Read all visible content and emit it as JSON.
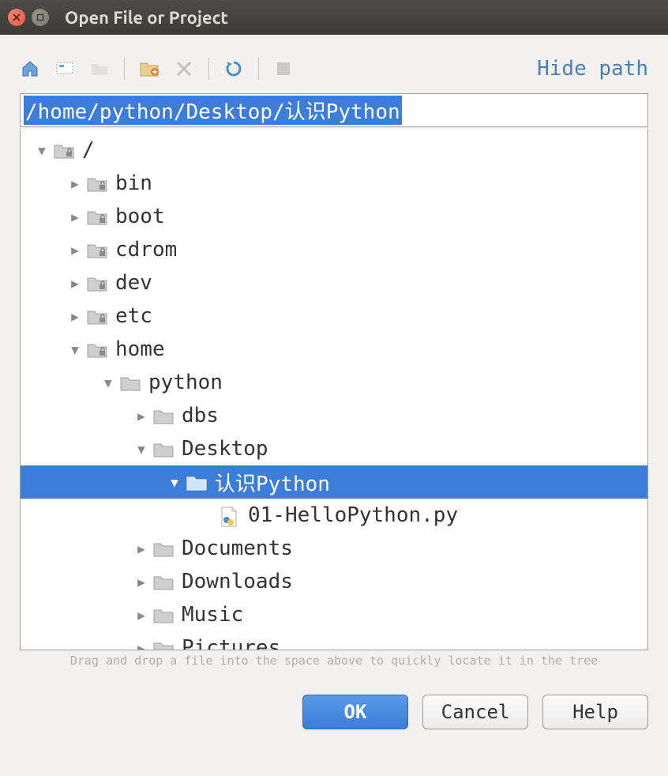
{
  "window": {
    "title": "Open File or Project"
  },
  "toolbar": {
    "hide_path": "Hide path"
  },
  "path_input": {
    "value": "/home/python/Desktop/认识Python"
  },
  "tree": {
    "items": [
      {
        "level": 0,
        "expanded": true,
        "kind": "folder-lock",
        "label": "/",
        "selected": false
      },
      {
        "level": 1,
        "expanded": false,
        "kind": "folder-lock",
        "label": "bin",
        "selected": false
      },
      {
        "level": 1,
        "expanded": false,
        "kind": "folder-lock",
        "label": "boot",
        "selected": false
      },
      {
        "level": 1,
        "expanded": false,
        "kind": "folder-lock",
        "label": "cdrom",
        "selected": false
      },
      {
        "level": 1,
        "expanded": false,
        "kind": "folder-lock",
        "label": "dev",
        "selected": false
      },
      {
        "level": 1,
        "expanded": false,
        "kind": "folder-lock",
        "label": "etc",
        "selected": false
      },
      {
        "level": 1,
        "expanded": true,
        "kind": "folder-lock",
        "label": "home",
        "selected": false
      },
      {
        "level": 2,
        "expanded": true,
        "kind": "folder",
        "label": "python",
        "selected": false
      },
      {
        "level": 3,
        "expanded": false,
        "kind": "folder",
        "label": "dbs",
        "selected": false
      },
      {
        "level": 3,
        "expanded": true,
        "kind": "folder",
        "label": "Desktop",
        "selected": false
      },
      {
        "level": 4,
        "expanded": true,
        "kind": "folder",
        "label": "认识Python",
        "selected": true
      },
      {
        "level": 5,
        "expanded": null,
        "kind": "pyfile",
        "label": "01-HelloPython.py",
        "selected": false
      },
      {
        "level": 3,
        "expanded": false,
        "kind": "folder",
        "label": "Documents",
        "selected": false
      },
      {
        "level": 3,
        "expanded": false,
        "kind": "folder",
        "label": "Downloads",
        "selected": false
      },
      {
        "level": 3,
        "expanded": false,
        "kind": "folder",
        "label": "Music",
        "selected": false
      },
      {
        "level": 3,
        "expanded": false,
        "kind": "folder",
        "label": "Pictures",
        "selected": false
      }
    ]
  },
  "hint": "Drag and drop a file into the space above to quickly locate it in the tree",
  "buttons": {
    "ok": "OK",
    "cancel": "Cancel",
    "help": "Help"
  }
}
